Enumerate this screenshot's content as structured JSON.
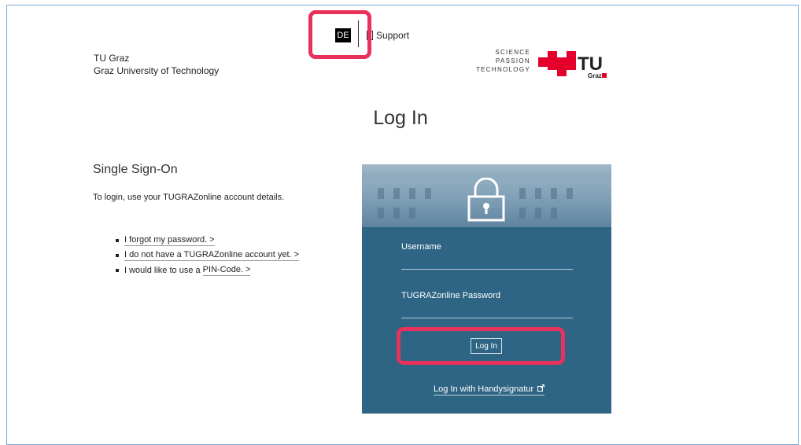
{
  "header": {
    "lang_button": "DE",
    "support_label": "Support",
    "org_name": "TU Graz",
    "org_full": "Graz University of Technology",
    "tagline": [
      "SCIENCE",
      "PASSION",
      "TECHNOLOGY"
    ],
    "logo_text": "TU",
    "logo_subtext": "Graz"
  },
  "main": {
    "title": "Log In",
    "sso_heading": "Single Sign-On",
    "sso_text": "To login, use your TUGRAZonline account details.",
    "links": [
      {
        "text": "I forgot my password.",
        "arrow": ">"
      },
      {
        "text": "I do not have a TUGRAZonline account yet.",
        "arrow": ">"
      },
      {
        "prefix": "I would like to use a ",
        "text": "PIN-Code.",
        "arrow": ">"
      }
    ]
  },
  "login_panel": {
    "username_label": "Username",
    "password_label": "TUGRAZonline Password",
    "login_button": "Log In",
    "handysignatur_link": "Log In with Handysignatur"
  },
  "colors": {
    "panel": "#2e6585",
    "highlight": "#e8315b",
    "brand_red": "#e4002b"
  },
  "icons": {
    "support": "document-icon",
    "lock": "padlock-icon",
    "external": "external-link-icon"
  }
}
